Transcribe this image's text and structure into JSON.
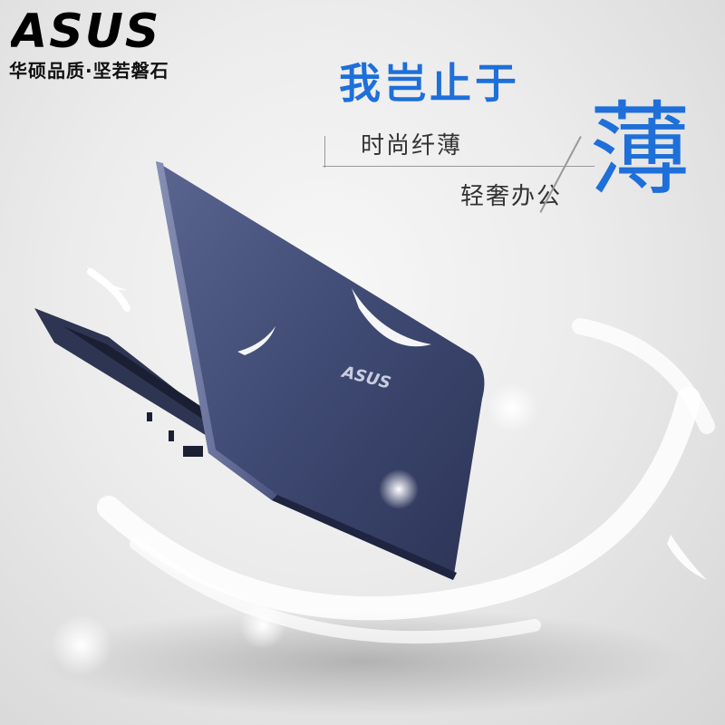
{
  "brand": {
    "logo_text": "ASUS",
    "tagline": "华硕品质·坚若磐石"
  },
  "headline": {
    "title": "我岂止于",
    "line1": "时尚纤薄",
    "line2": "轻奢办公",
    "big_char": "薄"
  },
  "product": {
    "lid_logo": "ASUS"
  },
  "colors": {
    "accent": "#1e6fd9",
    "laptop": "#3f4a73",
    "background": "#ececec"
  }
}
